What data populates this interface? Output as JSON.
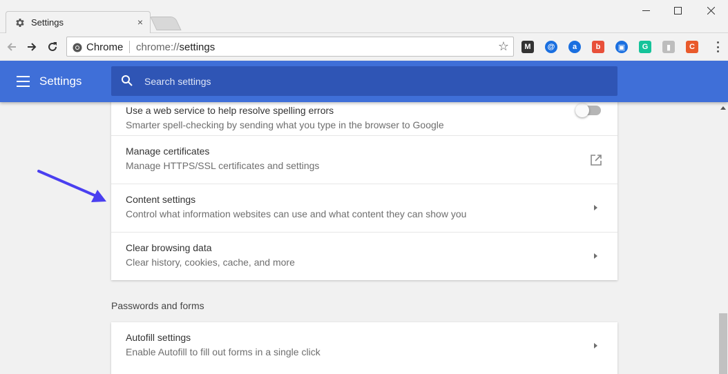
{
  "window": {
    "tab_title": "Settings",
    "tab_close": "×",
    "minimize": "—",
    "maximize": "☐",
    "close": "✕"
  },
  "toolbar": {
    "site_chip": "Chrome",
    "url_scheme": "chrome://",
    "url_path": "settings",
    "bookmark_star": "☆",
    "extensions": [
      {
        "name": "m-extension-icon",
        "color": "#333333",
        "glyph": "M"
      },
      {
        "name": "blue-circle-extension-icon",
        "color": "#1a6fe0",
        "glyph": "@"
      },
      {
        "name": "at-sign-extension-icon",
        "color": "#1a6fe0",
        "glyph": "a"
      },
      {
        "name": "red-round-extension-icon",
        "color": "#e8503a",
        "glyph": "b"
      },
      {
        "name": "calendar-extension-icon",
        "color": "#1a6fe0",
        "glyph": "▣"
      },
      {
        "name": "grammarly-extension-icon",
        "color": "#15c39a",
        "glyph": "G"
      },
      {
        "name": "clipboard-extension-icon",
        "color": "#bdbdbd",
        "glyph": "▮"
      },
      {
        "name": "orange-c-extension-icon",
        "color": "#e95a2b",
        "glyph": "C"
      }
    ]
  },
  "header": {
    "title": "Settings",
    "search_placeholder": "Search settings"
  },
  "advanced_card": {
    "rows": [
      {
        "title": "Use a web service to help resolve spelling errors",
        "subtitle": "Smarter spell-checking by sending what you type in the browser to Google"
      },
      {
        "title": "Manage certificates",
        "subtitle": "Manage HTTPS/SSL certificates and settings"
      },
      {
        "title": "Content settings",
        "subtitle": "Control what information websites can use and what content they can show you"
      },
      {
        "title": "Clear browsing data",
        "subtitle": "Clear history, cookies, cache, and more"
      }
    ]
  },
  "passwords_section": {
    "heading": "Passwords and forms",
    "rows": [
      {
        "title": "Autofill settings",
        "subtitle": "Enable Autofill to fill out forms in a single click"
      }
    ]
  },
  "colors": {
    "header_blue": "#3f6fd8",
    "search_blue": "#2f55b5",
    "annotation_arrow": "#4a3ff0"
  }
}
